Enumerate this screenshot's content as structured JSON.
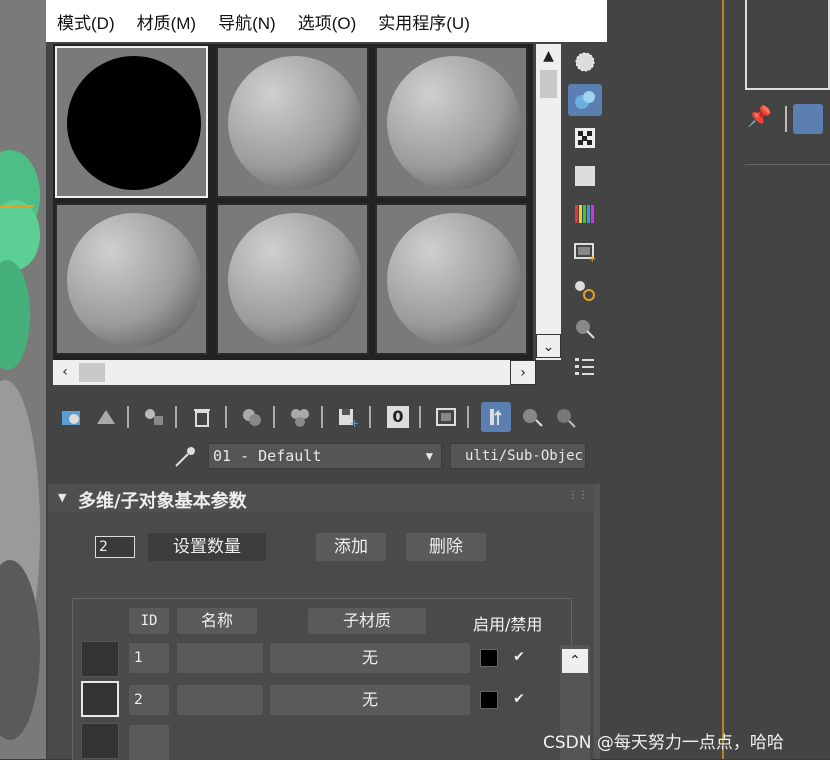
{
  "menu": [
    "模式(D)",
    "材质(M)",
    "导航(N)",
    "选项(O)",
    "实用程序(U)"
  ],
  "material": {
    "name": "01 - Default",
    "type": "ulti/Sub-Objec"
  },
  "rollout": {
    "title": "多维/子对象基本参数",
    "count_value": "2",
    "set_count_label": "设置数量",
    "add_label": "添加",
    "delete_label": "删除"
  },
  "table": {
    "headers": {
      "id": "ID",
      "name": "名称",
      "submaterial": "子材质",
      "enable": "启用/禁用"
    },
    "rows": [
      {
        "id": "1",
        "name": "",
        "submaterial": "无",
        "enabled": true
      },
      {
        "id": "2",
        "name": "",
        "submaterial": "无",
        "enabled": true
      }
    ]
  },
  "toolbar_zero_label": "0",
  "watermark": "CSDN @每天努力一点点，哈哈",
  "colors": {
    "accent": "#5a7fb0",
    "guide_line": "#b48a20",
    "highlight_green": "#4dbf86"
  }
}
